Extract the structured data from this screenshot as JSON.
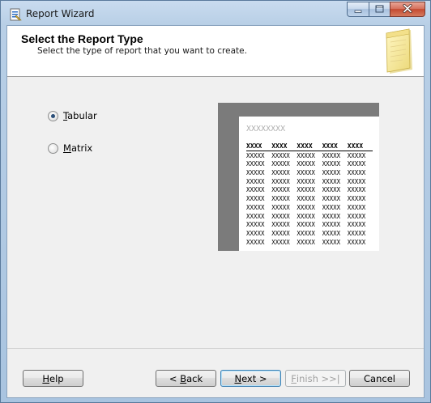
{
  "window": {
    "title": "Report Wizard",
    "icon": "report-wizard-icon",
    "caption_buttons": [
      "minimize",
      "maximize",
      "close"
    ]
  },
  "header": {
    "title": "Select the Report Type",
    "subtitle": "Select the type of report that you want to create.",
    "art_icon": "notepad-icon"
  },
  "report_types": {
    "tabular": {
      "access_key": "T",
      "label_rest": "abular",
      "selected": true
    },
    "matrix": {
      "access_key": "M",
      "label_rest": "atrix",
      "selected": false
    }
  },
  "preview": {
    "title": "XXXXXXXX",
    "columns": [
      "XXXX",
      "XXXX",
      "XXXX",
      "XXXX",
      "XXXX"
    ],
    "rows": [
      [
        "XXXXX",
        "XXXXX",
        "XXXXX",
        "XXXXX",
        "XXXXX"
      ],
      [
        "XXXXX",
        "XXXXX",
        "XXXXX",
        "XXXXX",
        "XXXXX"
      ],
      [
        "XXXXX",
        "XXXXX",
        "XXXXX",
        "XXXXX",
        "XXXXX"
      ],
      [
        "XXXXX",
        "XXXXX",
        "XXXXX",
        "XXXXX",
        "XXXXX"
      ],
      [
        "XXXXX",
        "XXXXX",
        "XXXXX",
        "XXXXX",
        "XXXXX"
      ],
      [
        "XXXXX",
        "XXXXX",
        "XXXXX",
        "XXXXX",
        "XXXXX"
      ],
      [
        "XXXXX",
        "XXXXX",
        "XXXXX",
        "XXXXX",
        "XXXXX"
      ],
      [
        "XXXXX",
        "XXXXX",
        "XXXXX",
        "XXXXX",
        "XXXXX"
      ],
      [
        "XXXXX",
        "XXXXX",
        "XXXXX",
        "XXXXX",
        "XXXXX"
      ],
      [
        "XXXXX",
        "XXXXX",
        "XXXXX",
        "XXXXX",
        "XXXXX"
      ],
      [
        "XXXXX",
        "XXXXX",
        "XXXXX",
        "XXXXX",
        "XXXXX"
      ]
    ]
  },
  "buttons": {
    "help": {
      "access_key": "H",
      "label_rest": "elp"
    },
    "back": {
      "prefix": "< ",
      "access_key": "B",
      "label_rest": "ack"
    },
    "next": {
      "access_key": "N",
      "label_rest": "ext >"
    },
    "finish": {
      "access_key": "F",
      "label_rest": "inish >>|",
      "disabled": true
    },
    "cancel": {
      "label": "Cancel"
    }
  },
  "colors": {
    "selected_radio": "#2b4f79",
    "preview_background": "#7b7b7b",
    "close_button": "#c44a31"
  }
}
